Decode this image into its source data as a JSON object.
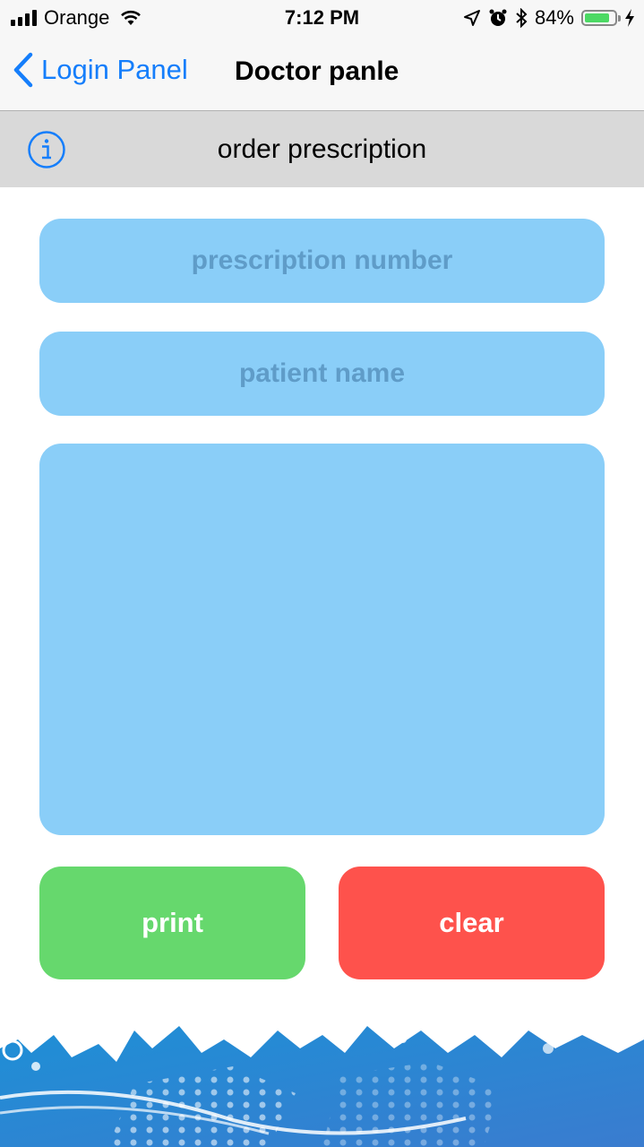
{
  "status_bar": {
    "carrier": "Orange",
    "time": "7:12 PM",
    "battery_percent": "84%",
    "battery_level": 0.84
  },
  "nav": {
    "back_label": "Login Panel",
    "title": "Doctor panle"
  },
  "section": {
    "title": "order prescription"
  },
  "form": {
    "prescription_number_placeholder": "prescription number",
    "patient_name_placeholder": "patient name",
    "notes_value": ""
  },
  "actions": {
    "print_label": "print",
    "clear_label": "clear"
  },
  "colors": {
    "accent": "#157efb",
    "field": "#8acef8",
    "print": "#66d86d",
    "clear": "#fe524c",
    "battery": "#4cd964"
  },
  "icons": {
    "back": "chevron-left-icon",
    "info": "info-icon",
    "signal": "cellular-signal-icon",
    "wifi": "wifi-icon",
    "location": "location-arrow-icon",
    "alarm": "alarm-icon",
    "bluetooth": "bluetooth-icon",
    "battery": "battery-icon",
    "charging": "charging-bolt-icon"
  }
}
